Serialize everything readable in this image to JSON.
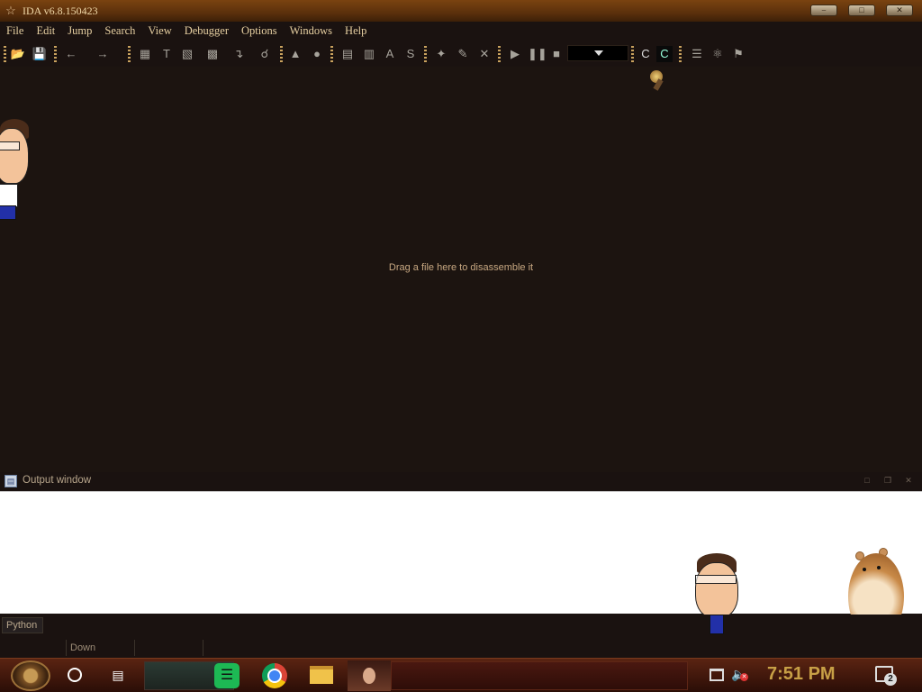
{
  "window": {
    "title": "IDA v6.8.150423",
    "buttons": [
      "minimize",
      "maximize",
      "close"
    ]
  },
  "menu": {
    "items": [
      "File",
      "Edit",
      "Jump",
      "Search",
      "View",
      "Debugger",
      "Options",
      "Windows",
      "Help"
    ]
  },
  "toolbar": {
    "icons": [
      "open-file-icon",
      "save-icon",
      "back-arrow-icon",
      "forward-arrow-icon",
      "make-code-icon",
      "make-text-icon",
      "make-data-icon",
      "make-array-icon",
      "jump-down-icon",
      "search-icon",
      "text-search-icon",
      "circle-icon",
      "code-icon",
      "unk-icon",
      "string-icon",
      "struct-icon",
      "add-breakpoint-icon",
      "edit-icon",
      "delete-icon",
      "play-icon",
      "pause-icon",
      "stop-icon",
      "debugger-combo",
      "plugin-c-icon",
      "plugin-c-dark-icon",
      "script-icon",
      "thread-icon",
      "trace-icon"
    ]
  },
  "main": {
    "drag_hint": "Drag a file here to disassemble it"
  },
  "output": {
    "title": "Output window"
  },
  "cmdbar": {
    "python_label": "Python"
  },
  "status": {
    "state": "Down"
  },
  "taskbar": {
    "time": "7:51 PM",
    "notification_count": "2"
  },
  "colors": {
    "title_bar": "#5b300c",
    "menu_text": "#e6cfa1",
    "main_bg": "#1c1410",
    "clock_text": "#c8a046"
  }
}
